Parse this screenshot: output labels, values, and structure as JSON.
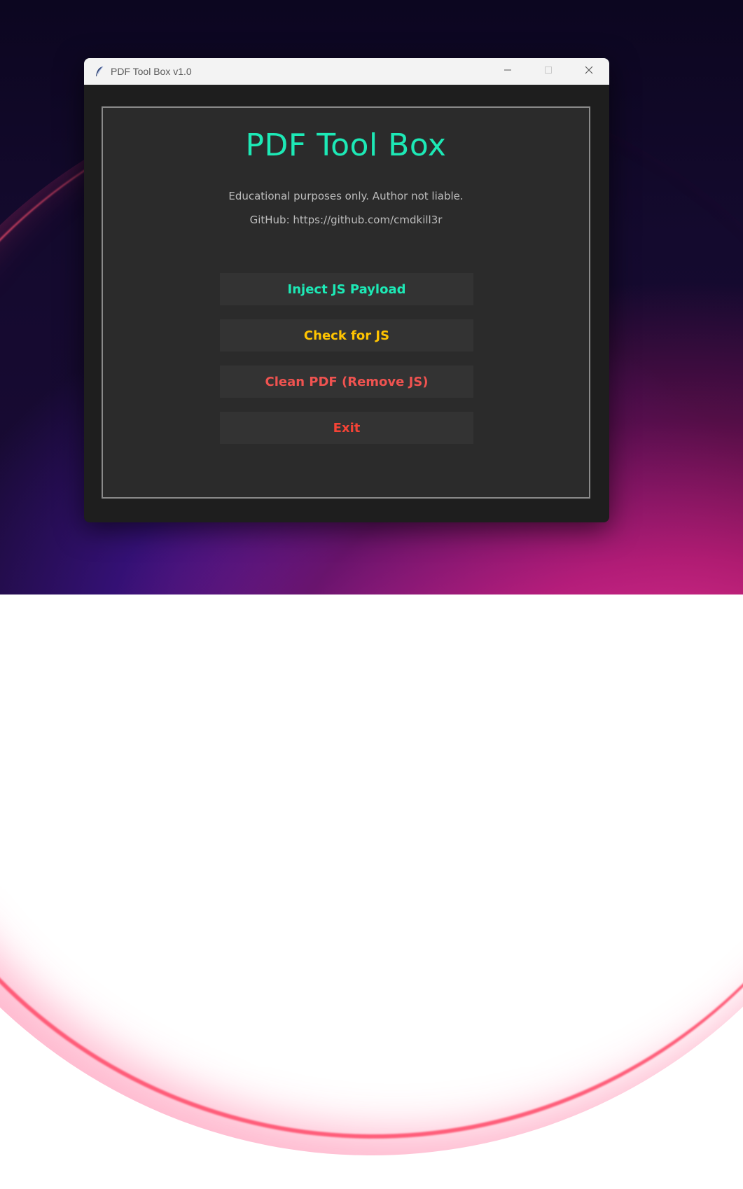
{
  "window": {
    "title": "PDF Tool Box v1.0",
    "icon": "feather-icon",
    "controls": [
      "minimize-icon",
      "maximize-icon",
      "close-icon"
    ]
  },
  "app": {
    "title": "PDF Tool Box",
    "disclaimer": "Educational purposes only. Author not liable.",
    "github": "GitHub: https://github.com/cmdkill3r"
  },
  "buttons": {
    "inject": "Inject JS Payload",
    "check": "Check for JS",
    "clean": "Clean PDF (Remove JS)",
    "exit": "Exit"
  },
  "colors": {
    "accent_teal": "#1de9b6",
    "accent_yellow": "#ffc400",
    "accent_red": "#ef5350",
    "exit_red": "#f44336",
    "panel_bg": "#2b2b2b",
    "button_bg": "#333333"
  }
}
